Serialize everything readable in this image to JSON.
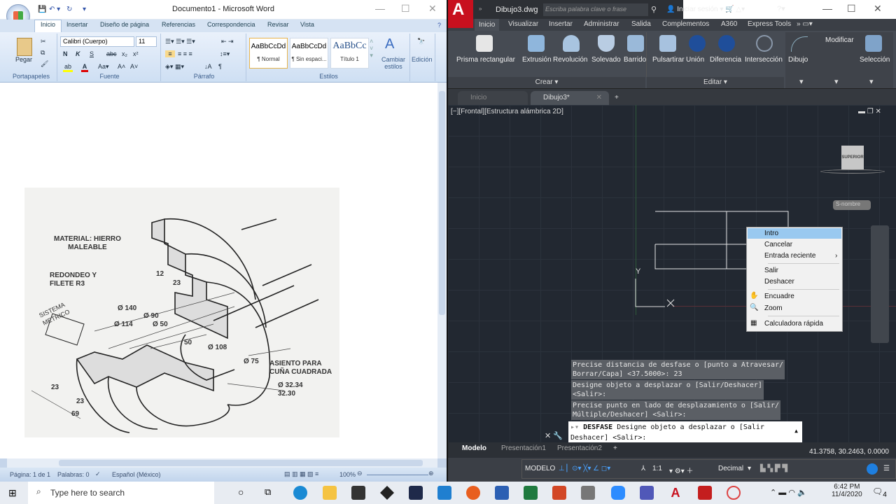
{
  "word": {
    "title": "Documento1 - Microsoft Word",
    "tabs": [
      "Inicio",
      "Insertar",
      "Diseño de página",
      "Referencias",
      "Correspondencia",
      "Revisar",
      "Vista"
    ],
    "clipboard": {
      "paste": "Pegar",
      "group": "Portapapeles"
    },
    "font": {
      "name": "Calibri (Cuerpo)",
      "size": "11",
      "group": "Fuente",
      "bold": "N",
      "italic": "K",
      "underline": "S"
    },
    "paragraph": {
      "group": "Párrafo"
    },
    "styles": {
      "group": "Estilos",
      "items": [
        {
          "preview": "AaBbCcDd",
          "name": "¶ Normal"
        },
        {
          "preview": "AaBbCcDd",
          "name": "¶ Sin espaci..."
        },
        {
          "preview": "AaBbCc",
          "name": "Título 1"
        }
      ],
      "change": "Cambiar estilos"
    },
    "editing": "Edición",
    "drawing_labels": {
      "material": "MATERIAL: HIERRO\nMALEABLE",
      "fillet": "REDONDEO Y\nFILETE R3",
      "system": "SISTEMA\nMETRICO",
      "d140": "Ø 140",
      "d114": "Ø 114",
      "d90": "Ø 90",
      "d50": "Ø 50",
      "d108": "Ø 108",
      "d75": "Ø 75",
      "l50": "50",
      "l12": "12",
      "l23a": "23",
      "l23b": "23",
      "l23c": "23",
      "l69": "69",
      "keyseat": "ASIENTO PARA\nCUÑA CUADRADA",
      "tol": "Ø 32.34\n   32.30"
    },
    "status": {
      "page": "Página: 1 de 1",
      "words": "Palabras: 0",
      "language": "Español (México)",
      "zoom": "100%"
    }
  },
  "autocad": {
    "title": "Dibujo3.dwg",
    "search_placeholder": "Escriba palabra clave o frase",
    "signin": "Iniciar sesión",
    "tabs": [
      "Inicio",
      "Visualizar",
      "Insertar",
      "Administrar",
      "Salida",
      "Complementos",
      "A360",
      "Express Tools"
    ],
    "create_tools": [
      "Prisma rectangular",
      "Extrusión",
      "Revolución",
      "Solevado",
      "Barrido"
    ],
    "edit_tools": [
      "Pulsartirar",
      "Unión",
      "Diferencia",
      "Intersección"
    ],
    "panels": {
      "create": "Crear ▾",
      "edit": "Editar ▾",
      "draw": "Dibujo",
      "modify": "Modificar",
      "selection": "Selección"
    },
    "doc_tabs": [
      "Inicio",
      "Dibujo3*"
    ],
    "viewport_label": "[−][Frontal][Estructura alámbrica 2D]",
    "viewcube": "SUPERIOR",
    "wcs": "S-nombre",
    "axis_y": "Y",
    "context_menu": [
      "Intro",
      "Cancelar",
      "Entrada reciente",
      "Salir",
      "Deshacer",
      "Encuadre",
      "Zoom",
      "Calculadora rápida"
    ],
    "history": [
      "Precise distancia de desfase o [punto a Atravesar/\nBorrar/Capa] <37.5000>: 23",
      "Designe objeto a desplazar o [Salir/Deshacer]\n<Salir>:",
      "Precise punto en lado de desplazamiento o [Salir/\nMúltiple/Deshacer] <Salir>:"
    ],
    "command": {
      "name": "DESFASE",
      "text": " Designe objeto a desplazar o [Salir",
      "text2": "Deshacer] <Salir>:"
    },
    "layout_tabs": [
      "Modelo",
      "Presentación1",
      "Presentación2"
    ],
    "coords": "41.3758, 30.2463, 0.0000",
    "status": {
      "model": "MODELO",
      "scale": "1:1",
      "units": "Decimal"
    }
  },
  "taskbar": {
    "search": "Type here to search",
    "time": "6:42 PM",
    "date": "11/4/2020",
    "notifications": "4"
  }
}
